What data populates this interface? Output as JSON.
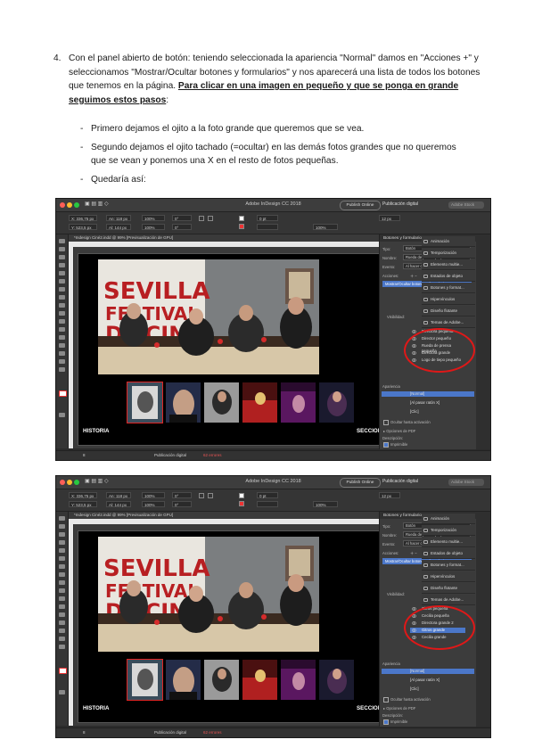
{
  "step": {
    "number": "4.",
    "text_before": "Con el panel abierto de botón: teniendo seleccionada la apariencia \"Normal\" damos en \"Acciones +\" y seleccionamos \"Mostrar/Ocultar botones y formularios\" y nos aparecerá una lista de todos los botones que tenemos en la página. ",
    "text_emphasis": "Para clicar en una imagen en pequeño y que se ponga en grande seguimos estos pasos",
    "text_after": ":"
  },
  "bullets": [
    "Primero dejamos el ojito a la foto grande que queremos que se vea.",
    "Segundo dejamos el ojito tachado (=ocultar) en las demás fotos grandes que no queremos que se vean y ponemos una X en el resto de fotos pequeñas.",
    "Quedaría así:"
  ],
  "screenshots": [
    {
      "app_title": "Adobe InDesign CC 2018",
      "publish_button": "Publish Online",
      "workspace": "Publicación digital",
      "search_placeholder": "Adobe Stock",
      "doc_tab": "*Indesign Ciné2.indd @ 99% [Previsualización de GPU]",
      "section_left": "HISTORIA",
      "section_right": "SECCIONE",
      "status_page": "8",
      "status_profile": "Publicación digital",
      "status_errors": "62 errores",
      "panel": {
        "title": "Botones y formularios",
        "type_label": "Tipo:",
        "type_value": "Botón",
        "name_label": "Nombre:",
        "name_value": "Rueda de prensa pequeña",
        "event_label": "Evento:",
        "event_value": "Al hacer clic",
        "actions_label": "Acciones:",
        "action_item": "Mostrar/Ocultar botones y formularios",
        "visible_label": "Visibilidad:",
        "items": [
          "Directora pequeña",
          "Director pequeño",
          "Rueda de prensa pequeña",
          "Directora grande",
          "Logo de tiepo pequeño"
        ],
        "selected_index": -1,
        "appearance_label": "Apariencia",
        "appearance_items": [
          "[Normal]",
          "[Al pasar ratón X]",
          "[Clic]"
        ],
        "hidden_label": "Ocultar hasta activación",
        "pdf_label": "Opciones de PDF",
        "description_label": "Descripción:",
        "printable_label": "Imprimible"
      },
      "right_panels": [
        "Animación",
        "Temporización",
        "Elemento multie...",
        "Estados de objeto",
        "Botones y format...",
        "Hipervínculos",
        "Diseño flotante",
        "Temas de Adobe..."
      ]
    },
    {
      "app_title": "Adobe InDesign CC 2018",
      "publish_button": "Publish Online",
      "workspace": "Publicación digital",
      "search_placeholder": "Adobe Stock",
      "doc_tab": "*Indesign Ciné2.indd @ 99% [Previsualización de GPU]",
      "section_left": "HISTORIA",
      "section_right": "SECCIONE",
      "status_page": "8",
      "status_profile": "Publicación digital",
      "status_errors": "62 errores",
      "panel": {
        "title": "Botones y formularios",
        "type_label": "Tipo:",
        "type_value": "Botón",
        "name_label": "Nombre:",
        "name_value": "Rueda de prensa pequeña",
        "event_label": "Evento:",
        "event_value": "Al hacer clic",
        "actions_label": "Acciones:",
        "action_item": "Mostrar/Ocultar botones y formularios",
        "visible_label": "Visibilidad:",
        "items": [
          "Gitros pequeña",
          "Cecilia pequeña",
          "Directora grande 2",
          "Gitros grande",
          "Cecilia grande"
        ],
        "selected_index": 3,
        "appearance_label": "Apariencia",
        "appearance_items": [
          "[Normal]",
          "[Al pasar ratón X]",
          "[Clic]"
        ],
        "hidden_label": "Ocultar hasta activación",
        "pdf_label": "Opciones de PDF",
        "description_label": "Descripción:",
        "printable_label": "Imprimible"
      },
      "right_panels": [
        "Animación",
        "Temporización",
        "Elemento multie...",
        "Estados de objeto",
        "Botones y format...",
        "Hipervínculos",
        "Diseño flotante",
        "Temas de Adobe..."
      ]
    }
  ],
  "colors": {
    "highlight_red": "#e01818",
    "selection_blue": "#4b77c9"
  }
}
